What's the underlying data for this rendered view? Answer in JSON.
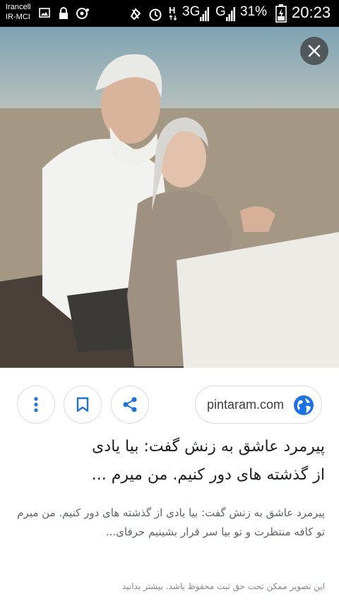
{
  "status_bar": {
    "carrier_1": "Irancell",
    "carrier_2": "IR-MCI",
    "network_1": "3G",
    "network_2": "G",
    "battery_percent": "31%",
    "time": "20:23",
    "icons": [
      "image-icon",
      "lock-icon",
      "assistant-icon",
      "vibrate-off-icon",
      "alarm-icon",
      "h-network-icon",
      "signal-icon",
      "battery-icon"
    ]
  },
  "image": {
    "description_icon": "photo"
  },
  "actions": {
    "more": "more-vert-icon",
    "save": "bookmark-icon",
    "share": "share-icon"
  },
  "source": {
    "domain": "pintaram.com",
    "icon": "globe-icon",
    "accent_color": "#1a73e8"
  },
  "content": {
    "title_line_1": "پیرمرد عاشق به زنش گفت: بیا یادی",
    "title_line_2": "از گذشته های دور کنیم. من میرم ...",
    "description": "پیرمرد عاشق به زنش گفت: بیا یادی از گذشته های دور کنیم. من میرم تو کافه منتظرت و تو بیا سر قرار بشینیم حرفای...",
    "notice": "این تصویر ممکن تحت حق ثبت محفوظ باشد. بیشتر بدانید"
  }
}
